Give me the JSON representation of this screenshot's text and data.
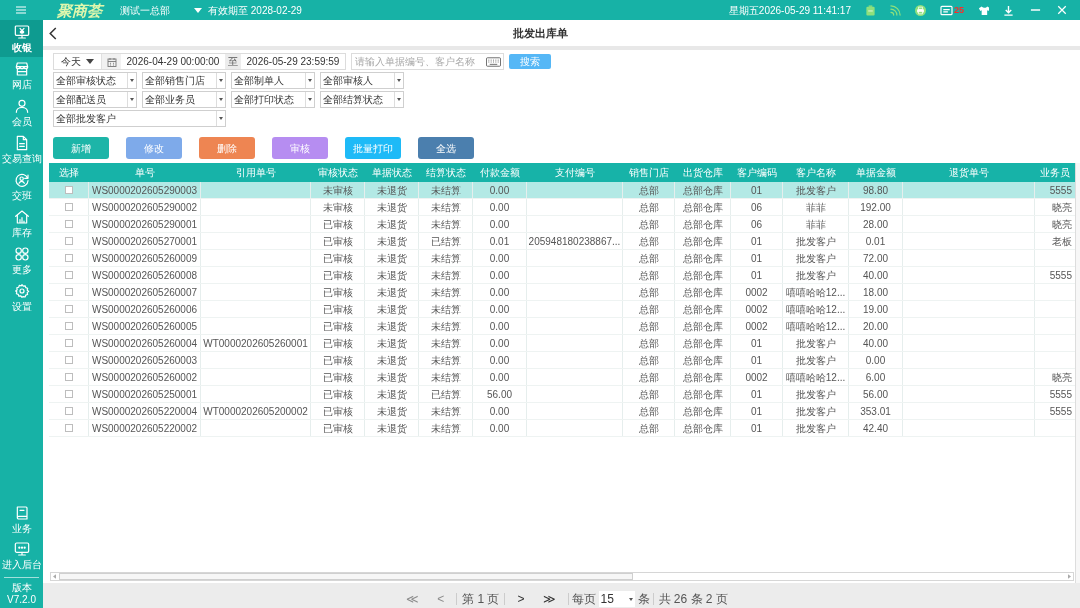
{
  "topbar": {
    "logo": "聚商荟",
    "store": "测试一总部",
    "expiry": "有效期至 2028-02-29",
    "datetime": "星期五2026-05-29 11:41:17",
    "message_count": "25"
  },
  "sidebar": {
    "items": [
      {
        "label": "收银",
        "selected": true
      },
      {
        "label": "网店",
        "selected": false
      },
      {
        "label": "会员",
        "selected": false
      },
      {
        "label": "交易查询",
        "selected": false
      },
      {
        "label": "交班",
        "selected": false
      },
      {
        "label": "库存",
        "selected": false
      },
      {
        "label": "更多",
        "selected": false
      },
      {
        "label": "设置",
        "selected": false
      }
    ],
    "bottom_items": [
      {
        "label": "业务",
        "selected": false
      },
      {
        "label": "进入后台",
        "selected": false
      }
    ],
    "version_label": "版本",
    "version": "V7.2.0"
  },
  "page": {
    "title": "批发出库单"
  },
  "filters": {
    "period": "今天",
    "date_from": "2026-04-29 00:00:00",
    "date_separator": "至",
    "date_to": "2026-05-29 23:59:59",
    "search": {
      "placeholder": "请输入单据编号、客户名称"
    },
    "search_button": "搜索",
    "select_rows": [
      [
        "全部审核状态",
        "全部销售门店",
        "全部制单人",
        "全部审核人"
      ],
      [
        "全部配送员",
        "全部业务员",
        "全部打印状态",
        "全部结算状态"
      ],
      [
        "全部批发客户"
      ]
    ]
  },
  "actions": [
    {
      "label": "新增",
      "color": "#1db5a8"
    },
    {
      "label": "修改",
      "color": "#7eaaea"
    },
    {
      "label": "删除",
      "color": "#ee8552"
    },
    {
      "label": "审核",
      "color": "#b68df1"
    },
    {
      "label": "批量打印",
      "color": "#1ebaf7"
    },
    {
      "label": "全选",
      "color": "#4b7fae"
    }
  ],
  "table": {
    "columns": [
      "选择",
      "单号",
      "引用单号",
      "审核状态",
      "单据状态",
      "结算状态",
      "付款金额",
      "支付编号",
      "销售门店",
      "出货仓库",
      "客户编码",
      "客户名称",
      "单据金额",
      "退货单号",
      "业务员"
    ],
    "rows": [
      {
        "selected": true,
        "checked": false,
        "order_no": "WS0000202605290003",
        "review_status": "未审核",
        "document_status": "未退货",
        "settlement_status": "未结算",
        "payment_amount": "0.00",
        "store": "总部",
        "warehouse": "总部仓库",
        "customer_code": "01",
        "customer_name": "批发客户",
        "amount": "98.80",
        "salesperson": "5555"
      },
      {
        "selected": false,
        "checked": false,
        "order_no": "WS0000202605290002",
        "review_status": "未审核",
        "document_status": "未退货",
        "settlement_status": "未结算",
        "payment_amount": "0.00",
        "store": "总部",
        "warehouse": "总部仓库",
        "customer_code": "06",
        "customer_name": "菲菲",
        "amount": "192.00",
        "salesperson": "晓亮"
      },
      {
        "selected": false,
        "checked": false,
        "order_no": "WS0000202605290001",
        "review_status": "已审核",
        "document_status": "未退货",
        "settlement_status": "未结算",
        "payment_amount": "0.00",
        "store": "总部",
        "warehouse": "总部仓库",
        "customer_code": "06",
        "customer_name": "菲菲",
        "amount": "28.00",
        "salesperson": "晓亮"
      },
      {
        "selected": false,
        "checked": false,
        "order_no": "WS0000202605270001",
        "review_status": "已审核",
        "document_status": "未退货",
        "settlement_status": "已结算",
        "payment_amount": "0.01",
        "payment_no": "205948180238867...",
        "store": "总部",
        "warehouse": "总部仓库",
        "customer_code": "01",
        "customer_name": "批发客户",
        "amount": "0.01",
        "salesperson": "老板"
      },
      {
        "selected": false,
        "checked": false,
        "order_no": "WS0000202605260009",
        "review_status": "已审核",
        "document_status": "未退货",
        "settlement_status": "未结算",
        "payment_amount": "0.00",
        "store": "总部",
        "warehouse": "总部仓库",
        "customer_code": "01",
        "customer_name": "批发客户",
        "amount": "72.00"
      },
      {
        "selected": false,
        "checked": false,
        "order_no": "WS0000202605260008",
        "review_status": "已审核",
        "document_status": "未退货",
        "settlement_status": "未结算",
        "payment_amount": "0.00",
        "store": "总部",
        "warehouse": "总部仓库",
        "customer_code": "01",
        "customer_name": "批发客户",
        "amount": "40.00",
        "salesperson": "5555"
      },
      {
        "selected": false,
        "checked": false,
        "order_no": "WS0000202605260007",
        "review_status": "已审核",
        "document_status": "未退货",
        "settlement_status": "未结算",
        "payment_amount": "0.00",
        "store": "总部",
        "warehouse": "总部仓库",
        "customer_code": "0002",
        "customer_name": "嘻嘻哈哈12...",
        "amount": "18.00"
      },
      {
        "selected": false,
        "checked": false,
        "order_no": "WS0000202605260006",
        "review_status": "已审核",
        "document_status": "未退货",
        "settlement_status": "未结算",
        "payment_amount": "0.00",
        "store": "总部",
        "warehouse": "总部仓库",
        "customer_code": "0002",
        "customer_name": "嘻嘻哈哈12...",
        "amount": "19.00"
      },
      {
        "selected": false,
        "checked": false,
        "order_no": "WS0000202605260005",
        "review_status": "已审核",
        "document_status": "未退货",
        "settlement_status": "未结算",
        "payment_amount": "0.00",
        "store": "总部",
        "warehouse": "总部仓库",
        "customer_code": "0002",
        "customer_name": "嘻嘻哈哈12...",
        "amount": "20.00"
      },
      {
        "selected": false,
        "checked": false,
        "order_no": "WS0000202605260004",
        "reference_no": "WT0000202605260001",
        "review_status": "已审核",
        "document_status": "未退货",
        "settlement_status": "未结算",
        "payment_amount": "0.00",
        "store": "总部",
        "warehouse": "总部仓库",
        "customer_code": "01",
        "customer_name": "批发客户",
        "amount": "40.00"
      },
      {
        "selected": false,
        "checked": false,
        "order_no": "WS0000202605260003",
        "review_status": "已审核",
        "document_status": "未退货",
        "settlement_status": "未结算",
        "payment_amount": "0.00",
        "store": "总部",
        "warehouse": "总部仓库",
        "customer_code": "01",
        "customer_name": "批发客户",
        "amount": "0.00"
      },
      {
        "selected": false,
        "checked": false,
        "order_no": "WS0000202605260002",
        "review_status": "已审核",
        "document_status": "未退货",
        "settlement_status": "未结算",
        "payment_amount": "0.00",
        "store": "总部",
        "warehouse": "总部仓库",
        "customer_code": "0002",
        "customer_name": "嘻嘻哈哈12...",
        "amount": "6.00",
        "salesperson": "晓亮"
      },
      {
        "selected": false,
        "checked": false,
        "order_no": "WS0000202605250001",
        "review_status": "已审核",
        "document_status": "未退货",
        "settlement_status": "已结算",
        "payment_amount": "56.00",
        "store": "总部",
        "warehouse": "总部仓库",
        "customer_code": "01",
        "customer_name": "批发客户",
        "amount": "56.00",
        "salesperson": "5555"
      },
      {
        "selected": false,
        "checked": false,
        "order_no": "WS0000202605220004",
        "reference_no": "WT0000202605200002",
        "review_status": "已审核",
        "document_status": "未退货",
        "settlement_status": "未结算",
        "payment_amount": "0.00",
        "store": "总部",
        "warehouse": "总部仓库",
        "customer_code": "01",
        "customer_name": "批发客户",
        "amount": "353.01",
        "salesperson": "5555"
      },
      {
        "selected": false,
        "checked": false,
        "order_no": "WS0000202605220002",
        "review_status": "已审核",
        "document_status": "未退货",
        "settlement_status": "未结算",
        "payment_amount": "0.00",
        "store": "总部",
        "warehouse": "总部仓库",
        "customer_code": "01",
        "customer_name": "批发客户",
        "amount": "42.40"
      }
    ]
  },
  "pagination": {
    "first": {
      "label": "≪",
      "disabled": true
    },
    "prev": {
      "label": "<",
      "disabled": true
    },
    "page": "第 1 页",
    "next": {
      "label": ">",
      "disabled": false
    },
    "last": {
      "label": "≫",
      "disabled": false
    },
    "per_page_label": "每页",
    "per_page": "15",
    "per_page_unit": "条",
    "summary": "共 26 条 2 页"
  }
}
